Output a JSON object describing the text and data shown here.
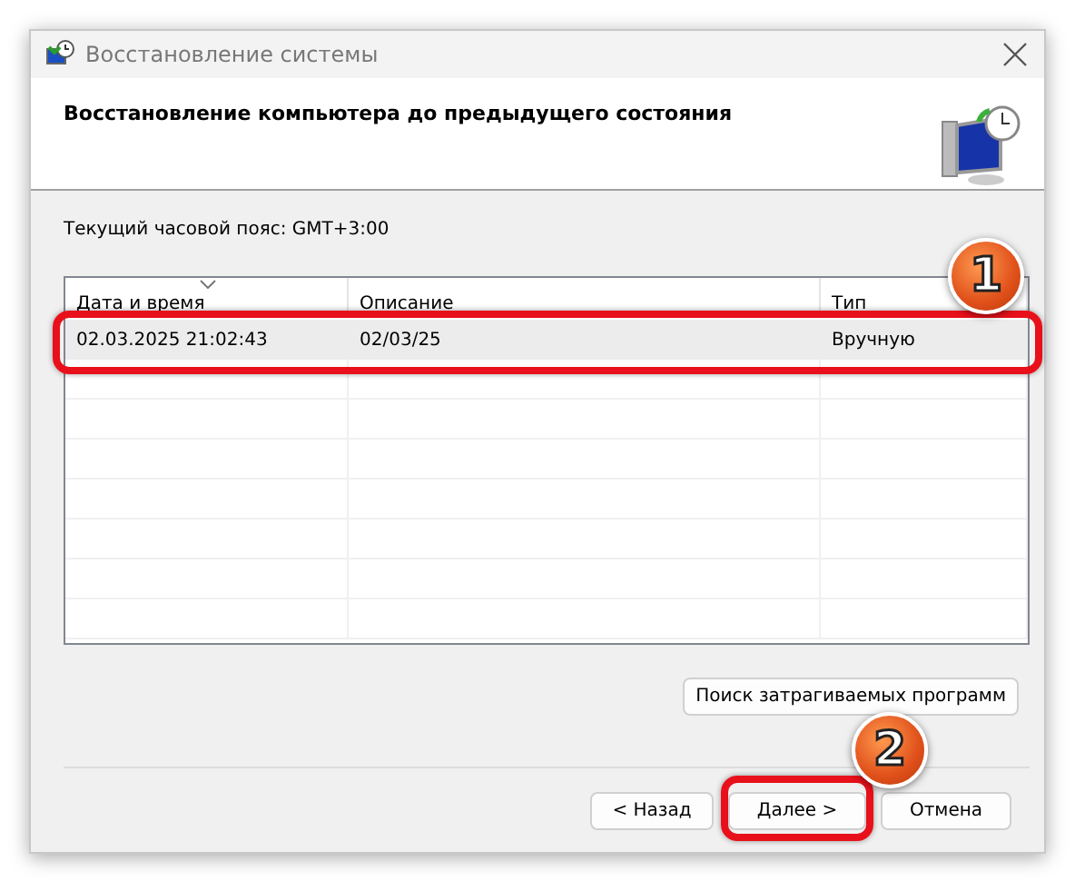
{
  "window": {
    "title": "Восстановление системы",
    "heading": "Восстановление компьютера до предыдущего состояния"
  },
  "timezone": "Текущий часовой пояс: GMT+3:00",
  "table": {
    "columns": [
      {
        "label": "Дата и время",
        "sorted": true
      },
      {
        "label": "Описание",
        "sorted": false
      },
      {
        "label": "Тип",
        "sorted": false
      }
    ],
    "rows": [
      {
        "cells": [
          "02.03.2025 21:02:43",
          "02/03/25",
          "Вручную"
        ],
        "selected": true,
        "highlighted": true
      }
    ]
  },
  "scan_button": "Поиск затрагиваемых программ",
  "buttons": [
    {
      "label": "< Назад",
      "highlighted": false
    },
    {
      "label": "Далее >",
      "highlighted": true
    },
    {
      "label": "Отмена",
      "highlighted": false
    }
  ],
  "markers": [
    "1",
    "2"
  ]
}
